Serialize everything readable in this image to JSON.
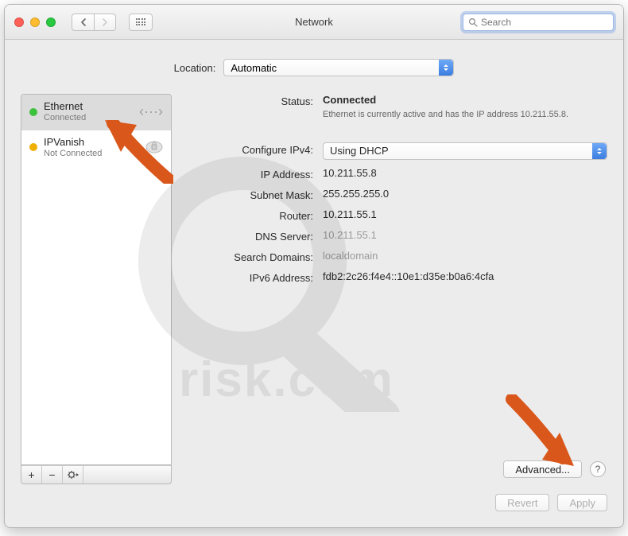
{
  "window": {
    "title": "Network"
  },
  "toolbar": {
    "search_placeholder": "Search"
  },
  "location": {
    "label": "Location:",
    "value": "Automatic"
  },
  "sidebar": {
    "items": [
      {
        "name": "Ethernet",
        "status": "Connected",
        "dot": "#3cc23c"
      },
      {
        "name": "IPVanish",
        "status": "Not Connected",
        "dot": "#f0b000"
      }
    ]
  },
  "details": {
    "status_label": "Status:",
    "status_value": "Connected",
    "status_desc": "Ethernet is currently active and has the IP address 10.211.55.8.",
    "configure_label": "Configure IPv4:",
    "configure_value": "Using DHCP",
    "ip_label": "IP Address:",
    "ip_value": "10.211.55.8",
    "subnet_label": "Subnet Mask:",
    "subnet_value": "255.255.255.0",
    "router_label": "Router:",
    "router_value": "10.211.55.1",
    "dns_label": "DNS Server:",
    "dns_value": "10.211.55.1",
    "search_label": "Search Domains:",
    "search_value": "localdomain",
    "ipv6_label": "IPv6 Address:",
    "ipv6_value": "fdb2:2c26:f4e4::10e1:d35e:b0a6:4cfa",
    "advanced_btn": "Advanced...",
    "help_btn": "?"
  },
  "footer": {
    "revert": "Revert",
    "apply": "Apply"
  },
  "watermark": "pcrisk.com"
}
